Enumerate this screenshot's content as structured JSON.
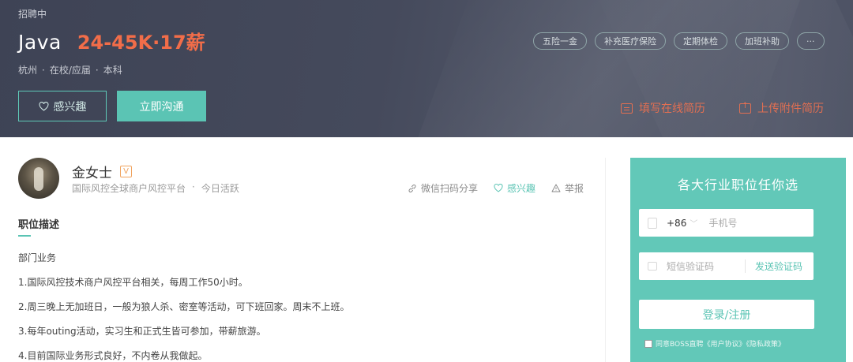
{
  "header": {
    "status": "招聘中",
    "job_title": "Java",
    "salary": "24-45K·17薪",
    "meta": [
      "杭州",
      "在校/应届",
      "本科"
    ],
    "meta_sep": "·",
    "tags": [
      "五险一金",
      "补充医疗保险",
      "定期体检",
      "加班补助",
      "···"
    ],
    "interest_label": "感兴趣",
    "chat_label": "立即沟通",
    "fill_resume_label": "填写在线简历",
    "upload_resume_label": "上传附件简历",
    "accent_color": "#5bc4b4",
    "salary_color": "#f26d49"
  },
  "boss": {
    "name": "金女士",
    "badge": "V",
    "company": "国际风控全球商户风控平台",
    "dot": "·",
    "activity": "今日活跃"
  },
  "actions": {
    "share": "微信扫码分享",
    "interest": "感兴趣",
    "report": "举报"
  },
  "description": {
    "section_title": "职位描述",
    "lines": [
      "部门业务",
      "1.国际风控技术商户风控平台相关，每周工作50小时。",
      "2.周三晚上无加班日，一般为狼人杀、密室等活动，可下班回家。周末不上班。",
      "3.每年outing活动，实习生和正式生皆可参加，带薪旅游。",
      "4.目前国际业务形式良好，不内卷从我做起。"
    ]
  },
  "login_panel": {
    "title": "各大行业职位任你选",
    "country_code": "+86",
    "phone_placeholder": "手机号",
    "code_placeholder": "短信验证码",
    "send_code": "发送验证码",
    "login_button": "登录/注册",
    "agree_text": "同意BOSS直聘《用户协议》《隐私政策》"
  }
}
